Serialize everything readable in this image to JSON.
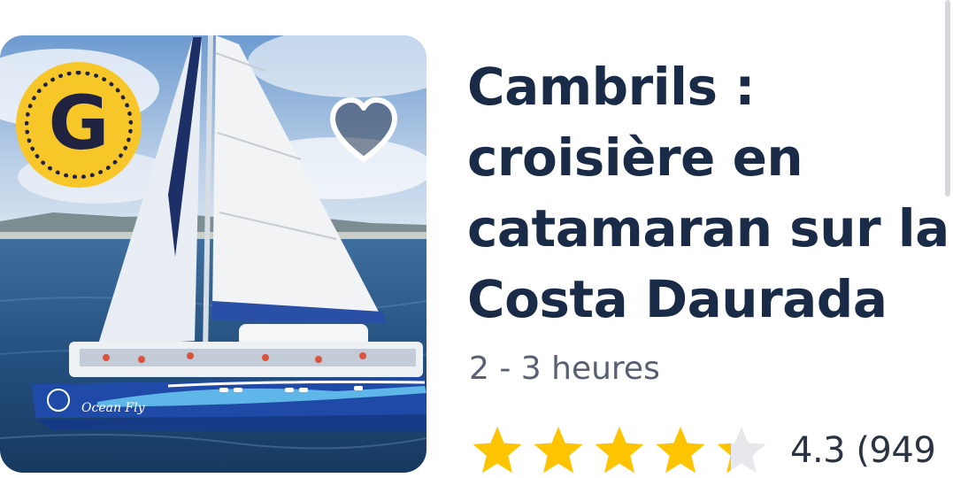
{
  "listing": {
    "title": "Cambrils : croisière en catamaran sur la Costa Daurada",
    "duration": "2 - 3 heures",
    "rating": 4.3,
    "rating_text": "4.3 (949",
    "stars_total": 5
  },
  "image": {
    "badge_letter": "G",
    "boat_name": "Ocean Fly"
  },
  "colors": {
    "title": "#1a2b48",
    "star": "#ffc400",
    "badge": "#f7c72a",
    "hull": "#1f4aa8"
  },
  "icons": {
    "favorite": "heart-icon",
    "badge": "getyourguide-logo-icon",
    "rating": "star-icon"
  }
}
